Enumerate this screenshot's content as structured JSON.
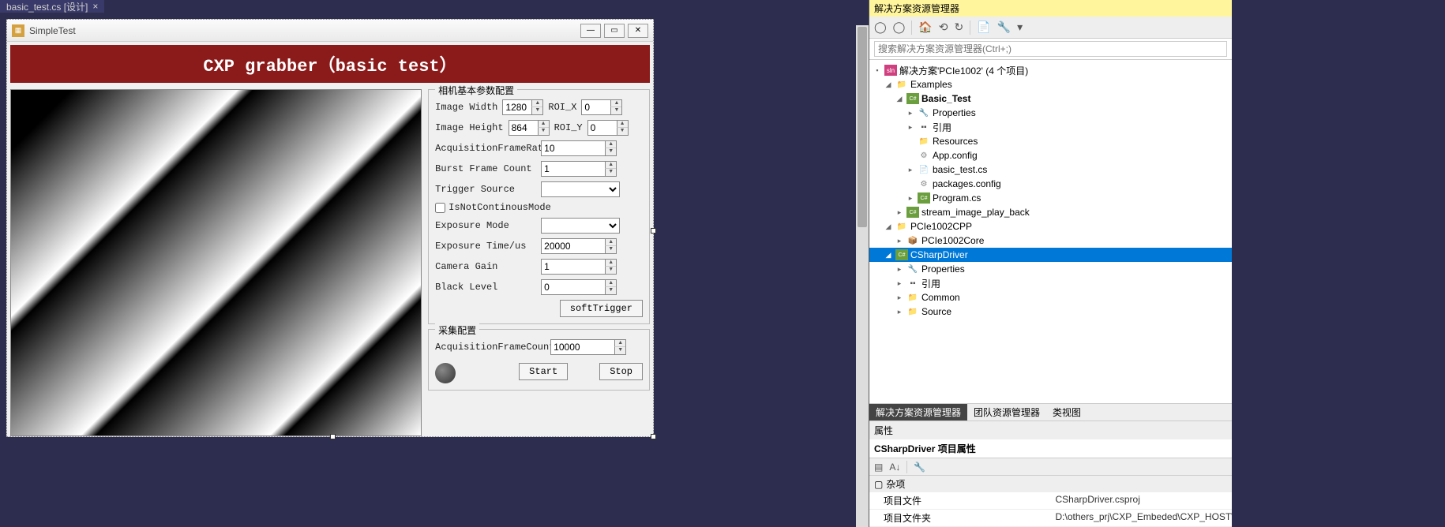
{
  "tab": {
    "label": "basic_test.cs [设计]",
    "close": "×"
  },
  "form": {
    "title": "SimpleTest",
    "min": "—",
    "max": "▭",
    "close": "✕",
    "banner": "CXP grabber（basic test）"
  },
  "params": {
    "group_title": "相机基本参数配置",
    "image_width_label": "Image Width",
    "image_width": "1280",
    "roi_x_label": "ROI_X",
    "roi_x": "0",
    "image_height_label": "Image Height",
    "image_height": "864",
    "roi_y_label": "ROI_Y",
    "roi_y": "0",
    "acq_framerate_label": "AcquisitionFrameRate",
    "acq_framerate": "10",
    "burst_label": "Burst Frame Count",
    "burst": "1",
    "trigger_source_label": "Trigger Source",
    "trigger_source": "",
    "not_continuous_label": "IsNotContinousMode",
    "exposure_mode_label": "Exposure Mode",
    "exposure_mode": "",
    "exposure_time_label": "Exposure Time/us",
    "exposure_time": "20000",
    "camera_gain_label": "Camera Gain",
    "camera_gain": "1",
    "black_level_label": "Black Level",
    "black_level": "0",
    "soft_trigger": "softTrigger"
  },
  "acq": {
    "group_title": "采集配置",
    "frame_counts_label": "AcquisitionFrameCounts",
    "frame_counts": "10000",
    "start": "Start",
    "stop": "Stop"
  },
  "sln": {
    "header": "解决方案资源管理器",
    "search_placeholder": "搜索解决方案资源管理器(Ctrl+;)",
    "root": "解决方案'PCIe1002' (4 个项目)",
    "nodes": {
      "examples": "Examples",
      "basic_test": "Basic_Test",
      "properties": "Properties",
      "refs": "引用",
      "resources": "Resources",
      "app_config": "App.config",
      "basic_test_cs": "basic_test.cs",
      "packages_config": "packages.config",
      "program_cs": "Program.cs",
      "stream_playback": "stream_image_play_back",
      "pcie_cpp": "PCIe1002CPP",
      "pcie_core": "PCIe1002Core",
      "csharp_driver": "CSharpDriver",
      "common": "Common",
      "source": "Source"
    },
    "bottom_tabs": {
      "t1": "解决方案资源管理器",
      "t2": "团队资源管理器",
      "t3": "类视图"
    }
  },
  "props": {
    "header": "属性",
    "title": "CSharpDriver 项目属性",
    "cat": "杂项",
    "rows": [
      {
        "k": "项目文件",
        "v": "CSharpDriver.csproj"
      },
      {
        "k": "项目文件夹",
        "v": "D:\\others_prj\\CXP_Embeded\\CXP_HOST\\sw\\"
      }
    ]
  }
}
